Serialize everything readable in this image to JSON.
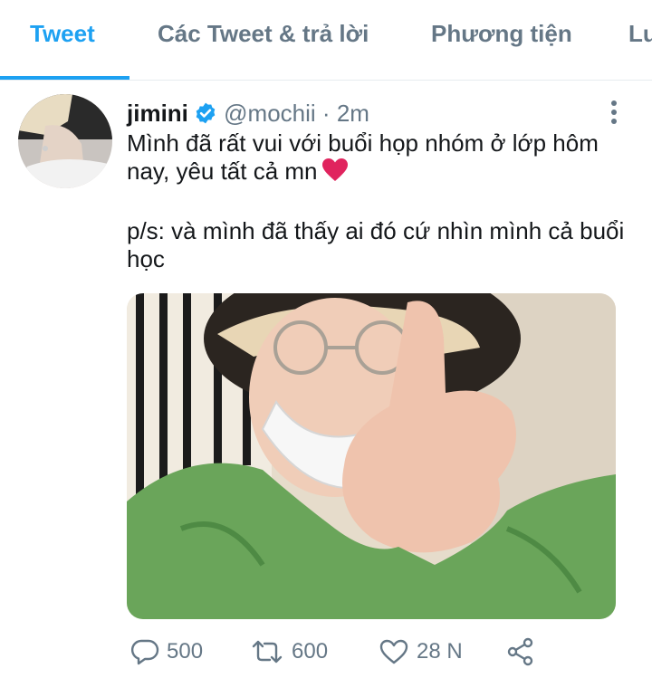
{
  "tabs": [
    {
      "label": "Tweet",
      "active": true
    },
    {
      "label": "Các Tweet & trả lời",
      "active": false
    },
    {
      "label": "Phương tiện",
      "active": false
    },
    {
      "label": "Lư",
      "active": false
    }
  ],
  "tweet": {
    "author_name": "jimini",
    "handle": "@mochii",
    "separator": "·",
    "time": "2m",
    "text_line1": "Mình đã rất vui với buổi họp nhóm ở lớp hôm nay, yêu tất cả mn",
    "text_line2": "p/s: và mình đã thấy ai đó cứ nhìn mình cả buổi học",
    "emoji": "red-heart"
  },
  "actions": {
    "reply_count": "500",
    "retweet_count": "600",
    "like_count": "28 N"
  },
  "colors": {
    "accent": "#1da1f2",
    "muted": "#657786",
    "text": "#14171a",
    "heart": "#e0245e"
  },
  "icons": [
    "verified-badge-icon",
    "more-vertical-icon",
    "reply-icon",
    "retweet-icon",
    "like-icon",
    "share-icon",
    "heart-emoji-icon"
  ]
}
